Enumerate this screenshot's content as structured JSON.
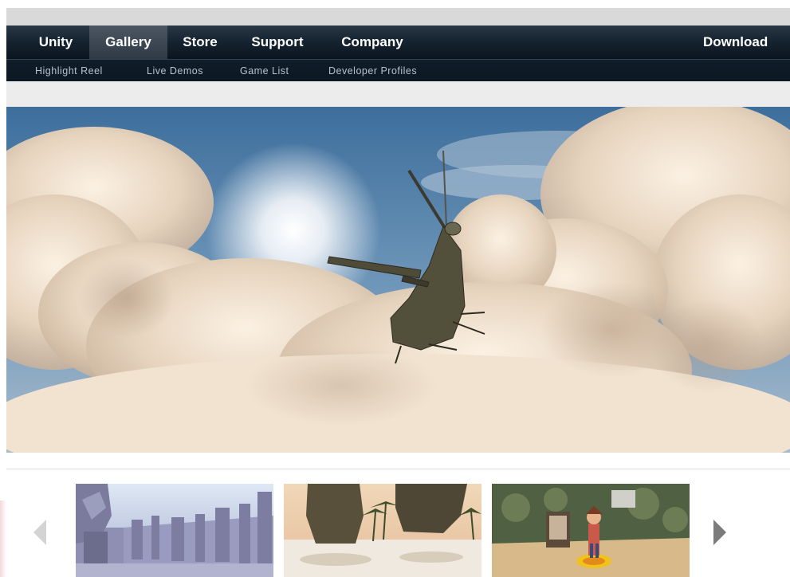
{
  "nav": {
    "main_items": [
      {
        "label": "Unity",
        "active": false
      },
      {
        "label": "Gallery",
        "active": true
      },
      {
        "label": "Store",
        "active": false
      },
      {
        "label": "Support",
        "active": false
      },
      {
        "label": "Company",
        "active": false
      }
    ],
    "download_label": "Download",
    "sub_items": [
      "Highlight Reel",
      "Live Demos",
      "Game List",
      "Developer Profiles"
    ]
  },
  "hero": {
    "image": "helicopter-in-clouds"
  },
  "carousel": {
    "prev_icon": "arrow-left-icon",
    "next_icon": "arrow-right-icon",
    "thumbnails": [
      {
        "image": "ruined-temple-scene"
      },
      {
        "image": "tropical-rocks-scene"
      },
      {
        "image": "character-in-room-scene"
      }
    ]
  },
  "colors": {
    "nav_background": "#0d1a26",
    "nav_active": "#3d4854",
    "sub_text": "#b9c2cb"
  }
}
